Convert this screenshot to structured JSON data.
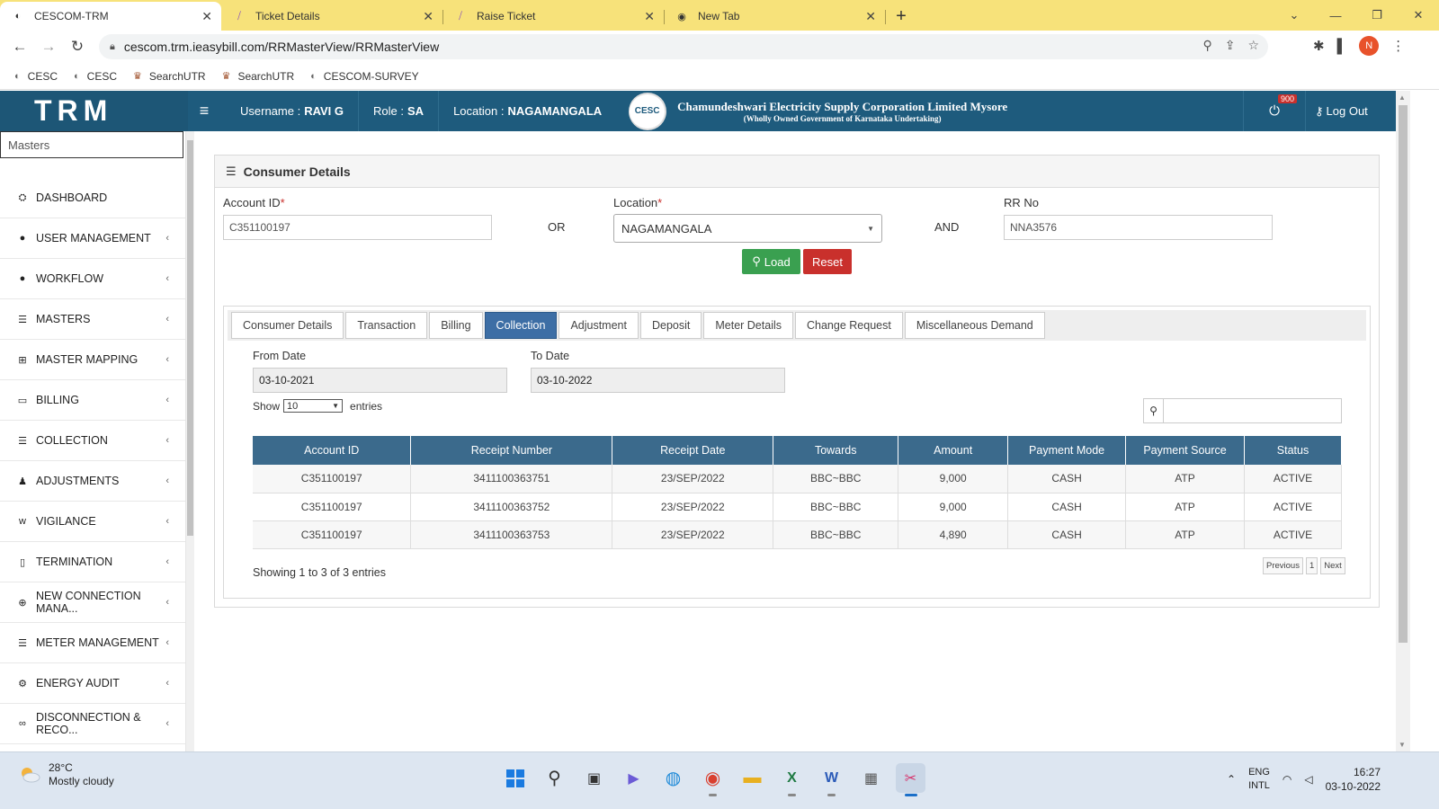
{
  "browser": {
    "tabs": [
      {
        "title": "CESCOM-TRM",
        "active": true
      },
      {
        "title": "Ticket Details",
        "active": false
      },
      {
        "title": "Raise Ticket",
        "active": false
      },
      {
        "title": "New Tab",
        "active": false
      }
    ],
    "url": "cescom.trm.ieasybill.com/RRMasterView/RRMasterView",
    "profile_initial": "N",
    "bookmarks": [
      "CESC",
      "CESC",
      "SearchUTR",
      "SearchUTR",
      "CESCOM-SURVEY"
    ]
  },
  "header": {
    "brand": "TRM",
    "username_label": "Username :",
    "username": "RAVI G",
    "role_label": "Role :",
    "role": "SA",
    "location_label": "Location :",
    "location": "NAGAMANGALA",
    "corp_name": "Chamundeshwari Electricity Supply Corporation Limited Mysore",
    "corp_sub": "(Wholly Owned Government of Karnataka Undertaking)",
    "notif_count": "900",
    "logout": "Log Out"
  },
  "sidebar": {
    "search_placeholder": "Masters",
    "items": [
      {
        "label": "DASHBOARD",
        "icon": "dashboard-icon",
        "glyph": "⛭",
        "chevron": false
      },
      {
        "label": "USER MANAGEMENT",
        "icon": "user-icon",
        "glyph": "●",
        "chevron": true
      },
      {
        "label": "WORKFLOW",
        "icon": "user-icon",
        "glyph": "●",
        "chevron": true
      },
      {
        "label": "MASTERS",
        "icon": "list-icon",
        "glyph": "☰",
        "chevron": true
      },
      {
        "label": "MASTER MAPPING",
        "icon": "sitemap-icon",
        "glyph": "⊞",
        "chevron": true
      },
      {
        "label": "BILLING",
        "icon": "monitor-icon",
        "glyph": "▭",
        "chevron": true
      },
      {
        "label": "COLLECTION",
        "icon": "list-icon",
        "glyph": "☰",
        "chevron": true
      },
      {
        "label": "ADJUSTMENTS",
        "icon": "users-icon",
        "glyph": "♟",
        "chevron": true
      },
      {
        "label": "VIGILANCE",
        "icon": "vk-icon",
        "glyph": "ᴡ",
        "chevron": true
      },
      {
        "label": "TERMINATION",
        "icon": "trash-icon",
        "glyph": "▯",
        "chevron": true
      },
      {
        "label": "NEW CONNECTION MANA...",
        "icon": "plus-circle-icon",
        "glyph": "⊕",
        "chevron": true
      },
      {
        "label": "METER MANAGEMENT",
        "icon": "list-icon",
        "glyph": "☰",
        "chevron": true
      },
      {
        "label": "ENERGY AUDIT",
        "icon": "cogs-icon",
        "glyph": "⚙",
        "chevron": true
      },
      {
        "label": "DISCONNECTION & RECO...",
        "icon": "link-icon",
        "glyph": "∞",
        "chevron": true
      }
    ]
  },
  "consumer": {
    "title": "Consumer Details",
    "account_label": "Account ID",
    "account_value": "C351100197",
    "or_text": "OR",
    "location_label": "Location",
    "location_value": "NAGAMANGALA",
    "and_text": "AND",
    "rr_label": "RR No",
    "rr_value": "NNA3576",
    "load_label": "Load",
    "reset_label": "Reset"
  },
  "tabs": [
    "Consumer Details",
    "Transaction",
    "Billing",
    "Collection",
    "Adjustment",
    "Deposit",
    "Meter Details",
    "Change Request",
    "Miscellaneous Demand"
  ],
  "active_tab": "Collection",
  "collection": {
    "from_label": "From Date",
    "from_value": "03-10-2021",
    "to_label": "To Date",
    "to_value": "03-10-2022",
    "show_label": "Show",
    "show_value": "10",
    "entries_label": "entries",
    "columns": [
      "Account ID",
      "Receipt Number",
      "Receipt Date",
      "Towards",
      "Amount",
      "Payment Mode",
      "Payment Source",
      "Status"
    ],
    "rows": [
      [
        "C351100197",
        "3411100363751",
        "23/SEP/2022",
        "BBC~BBC",
        "9,000",
        "CASH",
        "ATP",
        "ACTIVE"
      ],
      [
        "C351100197",
        "3411100363752",
        "23/SEP/2022",
        "BBC~BBC",
        "9,000",
        "CASH",
        "ATP",
        "ACTIVE"
      ],
      [
        "C351100197",
        "3411100363753",
        "23/SEP/2022",
        "BBC~BBC",
        "4,890",
        "CASH",
        "ATP",
        "ACTIVE"
      ]
    ],
    "showing_text": "Showing 1 to 3 of 3 entries",
    "prev_label": "Previous",
    "page_label": "1",
    "next_label": "Next"
  },
  "taskbar": {
    "temperature": "28°C",
    "weather": "Mostly cloudy",
    "lang1": "ENG",
    "lang2": "INTL",
    "time": "16:27",
    "date": "03-10-2022"
  },
  "colors": {
    "header_bg": "#1e5b7d",
    "tab_active": "#3d6ea5",
    "table_header": "#3b6a8c",
    "load_button": "#3aa050",
    "reset_button": "#c9302c",
    "tabbar_bg": "#f7e27a"
  }
}
